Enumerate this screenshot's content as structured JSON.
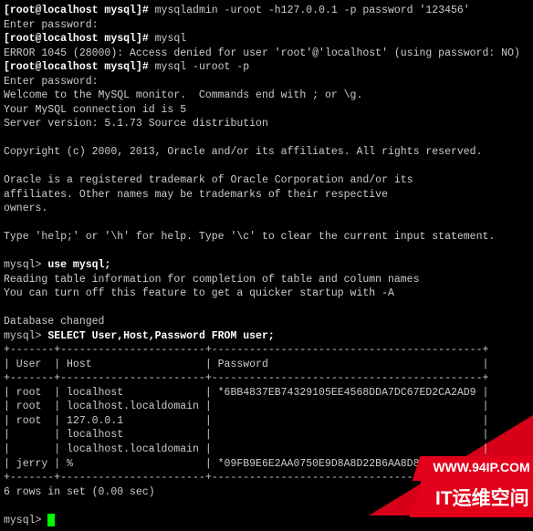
{
  "chart_data": {
    "type": "table",
    "title": "SELECT User,Host,Password FROM user",
    "columns": [
      "User",
      "Host",
      "Password"
    ],
    "rows": [
      [
        "root",
        "localhost",
        "*6BB4837EB74329105EE4568DDA7DC67ED2CA2AD9"
      ],
      [
        "root",
        "localhost.localdomain",
        ""
      ],
      [
        "root",
        "127.0.0.1",
        ""
      ],
      [
        "",
        "localhost",
        ""
      ],
      [
        "",
        "localhost.localdomain",
        ""
      ],
      [
        "jerry",
        "%",
        "*09FB9E6E2AA0750E9D8A8D22B6AA8D86C85BF"
      ]
    ],
    "footer": "6 rows in set (0.00 sec)"
  },
  "ps1": "[root@localhost mysql]# ",
  "cmd1": "mysqladmin -uroot -h127.0.0.1 -p password '123456'",
  "enterpw1": "Enter password:",
  "cmd2": "mysql",
  "err": "ERROR 1045 (28000): Access denied for user 'root'@'localhost' (using password: NO)",
  "cmd3": "mysql -uroot -p",
  "enterpw2": "Enter password:",
  "welcome1": "Welcome to the MySQL monitor.  Commands end with ; or \\g.",
  "welcome2": "Your MySQL connection id is 5",
  "welcome3": "Server version: 5.1.73 Source distribution",
  "copyright": "Copyright (c) 2000, 2013, Oracle and/or its affiliates. All rights reserved.",
  "bl1": "Oracle is a registered trademark of Oracle Corporation and/or its",
  "bl2": "affiliates. Other names may be trademarks of their respective",
  "bl3": "owners.",
  "help": "Type 'help;' or '\\h' for help. Type '\\c' to clear the current input statement.",
  "mysql_prompt": "mysql> ",
  "q1": "use mysql;",
  "r1a": "Reading table information for completion of table and column names",
  "r1b": "You can turn off this feature to get a quicker startup with -A",
  "r1c": "Database changed",
  "q2": "SELECT User,Host,Password FROM user;",
  "sep": "+-------+-----------------------+-------------------------------------------+",
  "hdr": "| User  | Host                  | Password                                  |",
  "row0": "| root  | localhost             | *6BB4837EB74329105EE4568DDA7DC67ED2CA2AD9 |",
  "row1": "| root  | localhost.localdomain |                                           |",
  "row2": "| root  | 127.0.0.1             |                                           |",
  "row3": "|       | localhost             |                                           |",
  "row4": "|       | localhost.localdomain |                                           |",
  "row5": "| jerry | %                     | *09FB9E6E2AA0750E9D8A8D22B6AA8D86C85BF",
  "footer": "6 rows in set (0.00 sec)",
  "watermark": {
    "label": "IT运维空间",
    "url": "WWW.94IP.COM"
  }
}
